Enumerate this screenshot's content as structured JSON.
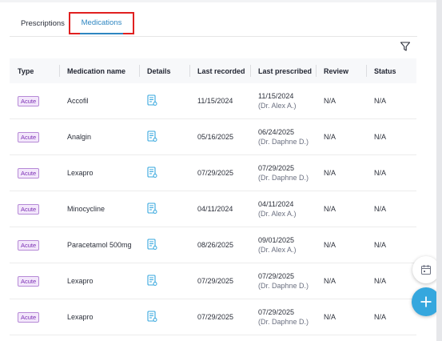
{
  "tabs": [
    {
      "label": "Prescriptions"
    },
    {
      "label": "Medications"
    }
  ],
  "table": {
    "headers": {
      "type": "Type",
      "name": "Medication name",
      "details": "Details",
      "last_recorded": "Last recorded",
      "last_prescribed": "Last prescribed",
      "review": "Review",
      "status": "Status"
    },
    "rows": [
      {
        "type": "Acute",
        "name": "Accofil",
        "recorded": "11/15/2024",
        "prescribed_date": "11/15/2024",
        "prescribed_by": "(Dr. Alex A.)",
        "review": "N/A",
        "status": "N/A"
      },
      {
        "type": "Acute",
        "name": "Analgin",
        "recorded": "05/16/2025",
        "prescribed_date": "06/24/2025",
        "prescribed_by": "(Dr. Daphne D.)",
        "review": "N/A",
        "status": "N/A"
      },
      {
        "type": "Acute",
        "name": "Lexapro",
        "recorded": "07/29/2025",
        "prescribed_date": "07/29/2025",
        "prescribed_by": "(Dr. Daphne D.)",
        "review": "N/A",
        "status": "N/A"
      },
      {
        "type": "Acute",
        "name": "Minocycline",
        "recorded": "04/11/2024",
        "prescribed_date": "04/11/2024",
        "prescribed_by": "(Dr. Alex A.)",
        "review": "N/A",
        "status": "N/A"
      },
      {
        "type": "Acute",
        "name": "Paracetamol 500mg",
        "recorded": "08/26/2025",
        "prescribed_date": "09/01/2025",
        "prescribed_by": "(Dr. Alex A.)",
        "review": "N/A",
        "status": "N/A"
      },
      {
        "type": "Acute",
        "name": "Lexapro",
        "recorded": "07/29/2025",
        "prescribed_date": "07/29/2025",
        "prescribed_by": "(Dr. Daphne D.)",
        "review": "N/A",
        "status": "N/A"
      },
      {
        "type": "Acute",
        "name": "Lexapro",
        "recorded": "07/29/2025",
        "prescribed_date": "07/29/2025",
        "prescribed_by": "(Dr. Daphne D.)",
        "review": "N/A",
        "status": "N/A"
      }
    ]
  },
  "icons": {
    "filter": "filter-icon",
    "details": "document-details-icon",
    "calendar": "calendar-icon",
    "add": "plus-icon"
  },
  "colors": {
    "accent": "#35a7de",
    "tab_active": "#2e86c1",
    "highlight_border": "#e02020",
    "badge_text": "#7b2fb4",
    "badge_bg": "#f3e7fb"
  }
}
